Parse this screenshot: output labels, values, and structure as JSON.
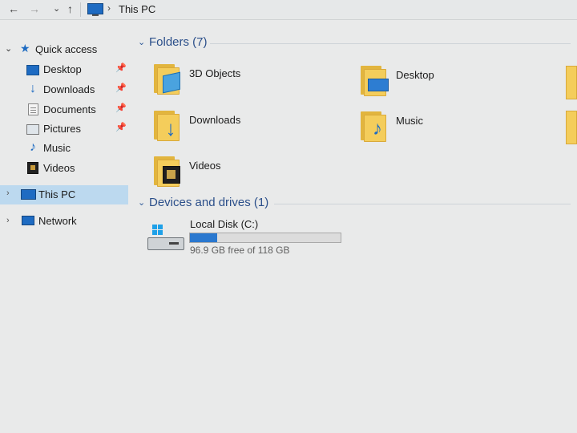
{
  "nav": {
    "back_icon": "←",
    "forward_icon": "→",
    "recent_icon": "⌄",
    "up_icon": "↑",
    "address_separator": "›",
    "address": "This PC"
  },
  "sidebar": {
    "quick_access": {
      "label": "Quick access",
      "expand_icon": "⌄",
      "icon": "star-icon"
    },
    "items": [
      {
        "label": "Desktop",
        "icon": "desktop-icon",
        "pinned": true
      },
      {
        "label": "Downloads",
        "icon": "downloads-icon",
        "pinned": true
      },
      {
        "label": "Documents",
        "icon": "documents-icon",
        "pinned": true
      },
      {
        "label": "Pictures",
        "icon": "pictures-icon",
        "pinned": true
      },
      {
        "label": "Music",
        "icon": "music-icon",
        "pinned": false
      },
      {
        "label": "Videos",
        "icon": "videos-icon",
        "pinned": false
      }
    ],
    "pin_glyph": "📌",
    "this_pc": {
      "label": "This PC",
      "chevron": "›",
      "selected": true
    },
    "network": {
      "label": "Network",
      "chevron": "›"
    }
  },
  "main": {
    "folders_group": {
      "title": "Folders (7)",
      "chevron": "⌄"
    },
    "folders": [
      {
        "label": "3D Objects",
        "icon": "3d-objects-icon"
      },
      {
        "label": "Desktop",
        "icon": "desktop-folder-icon"
      },
      {
        "label": "Downloads",
        "icon": "downloads-folder-icon",
        "glyph": "↓"
      },
      {
        "label": "Music",
        "icon": "music-folder-icon",
        "glyph": "♪"
      },
      {
        "label": "Videos",
        "icon": "videos-folder-icon"
      }
    ],
    "devices_group": {
      "title": "Devices and drives (1)",
      "chevron": "⌄"
    },
    "drive": {
      "label": "Local Disk (C:)",
      "free_text": "96.9 GB free of 118 GB",
      "used_fraction": 0.18,
      "bar_color": "#2a78cf"
    }
  },
  "colors": {
    "selection": "#bcd9ef",
    "accent": "#1e6bc2",
    "folder": "#f4cd5b",
    "group_title": "#2b4f8a"
  }
}
